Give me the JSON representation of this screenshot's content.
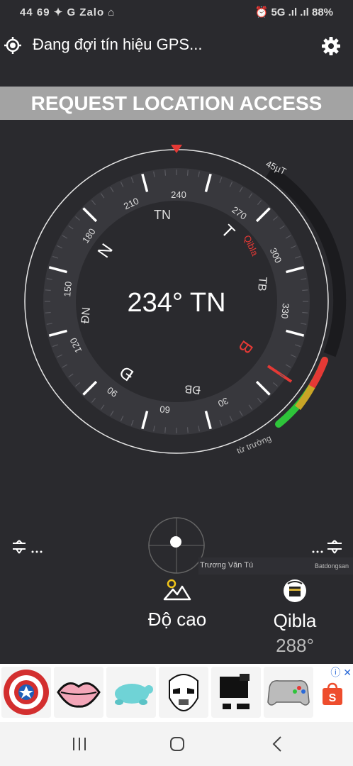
{
  "status": {
    "left": "44 69 ✦ G Zalo ⌂",
    "right": "⏰ 5G .ıl .ıl 88%"
  },
  "header": {
    "title": "Đang đợi tín hiệu GPS..."
  },
  "request_button": "REQUEST LOCATION ACCESS",
  "compass": {
    "heading": "234° TN",
    "field_strength": "45µT",
    "field_label": "từ trường",
    "qibla_label": "Qibla",
    "degree_ticks": [
      "240",
      "270",
      "300",
      "330",
      "30",
      "60",
      "90",
      "120",
      "150",
      "180",
      "210"
    ],
    "directions": [
      "TN",
      "T",
      "TB",
      "B",
      "ĐB",
      "Đ",
      "ĐN",
      "N"
    ]
  },
  "watermark": {
    "name": "Trương Văn Tú",
    "brand": "Batdongsan"
  },
  "bottom": {
    "altitude_label": "Độ cao",
    "qibla_label": "Qibla",
    "qibla_value": "288°"
  },
  "colors": {
    "accent_red": "#e53935",
    "field_green": "#22cc33",
    "background": "#2a2a2e"
  }
}
